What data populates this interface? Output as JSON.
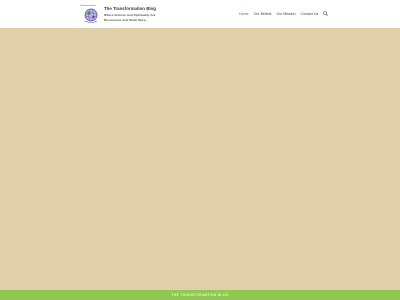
{
  "header": {
    "logo_caption": "Transformation",
    "site_title": "The Transformation Blog",
    "tagline": "Where Science And Spirituality Are Discovered, And Much More..."
  },
  "nav": {
    "items": [
      {
        "label": "Home",
        "active": true
      },
      {
        "label": "Our Beliefs",
        "active": false
      },
      {
        "label": "Our Mission",
        "active": false
      },
      {
        "label": "Contact Us",
        "active": false
      }
    ],
    "search_icon": "search-icon"
  },
  "colors": {
    "content_background": "#dfd0aa",
    "footer_background": "#8dc94e",
    "nav_active": "#3a6db5"
  },
  "footer": {
    "text": "THE TRANSFORMATION BLOG"
  }
}
